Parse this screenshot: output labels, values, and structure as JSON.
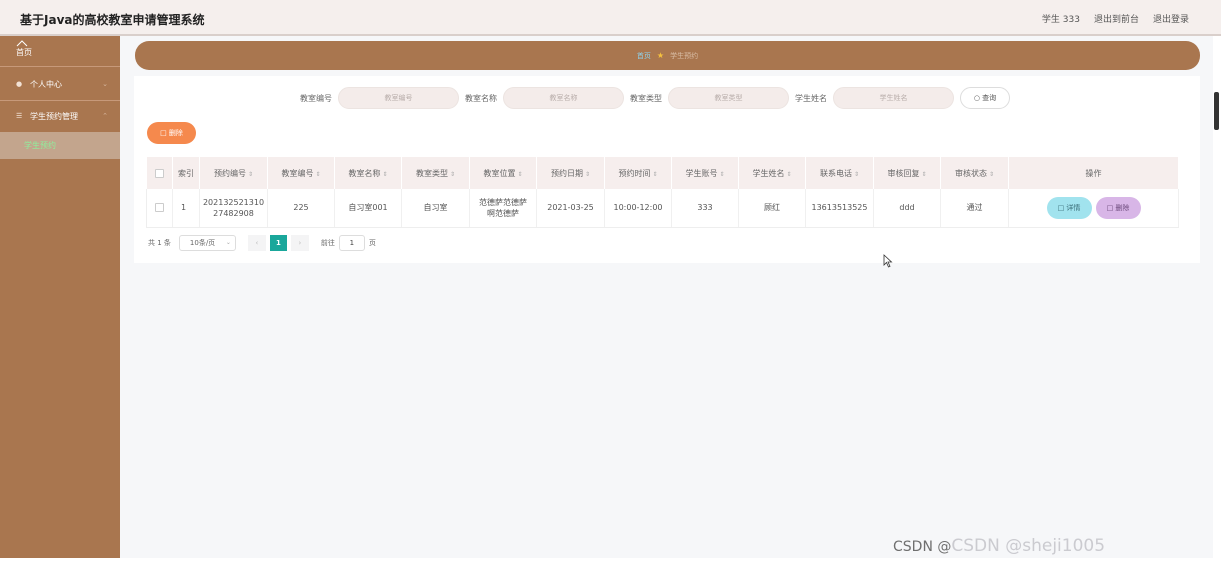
{
  "header": {
    "title": "基于Java的高校教室申请管理系统",
    "user": "学生 333",
    "back_front": "退出到前台",
    "logout": "退出登录"
  },
  "sidebar": {
    "home_label": "首页",
    "items": [
      {
        "label": "个人中心",
        "icon": "user-icon"
      },
      {
        "label": "学生预约管理",
        "icon": "menu-icon"
      }
    ],
    "sub_item": "学生预约"
  },
  "breadcrumb": {
    "home": "首页",
    "current": "学生预约"
  },
  "search": {
    "fields": [
      {
        "label": "教室编号",
        "placeholder": "教室编号"
      },
      {
        "label": "教室名称",
        "placeholder": "教室名称"
      },
      {
        "label": "教室类型",
        "placeholder": "教室类型"
      },
      {
        "label": "学生姓名",
        "placeholder": "学生姓名"
      }
    ],
    "query_button": "查询"
  },
  "delete_button": "删除",
  "table": {
    "columns": [
      "索引",
      "预约编号",
      "教室编号",
      "教室名称",
      "教室类型",
      "教室位置",
      "预约日期",
      "预约时间",
      "学生账号",
      "学生姓名",
      "联系电话",
      "审核回复",
      "审核状态",
      "操作"
    ],
    "rows": [
      {
        "index": "1",
        "booking_no_1": "202132521310",
        "booking_no_2": "27482908",
        "room_no": "225",
        "room_name": "自习室001",
        "room_type": "自习室",
        "location_1": "范德萨范德萨",
        "location_2": "啊范德萨",
        "date": "2021-03-25",
        "time": "10:00-12:00",
        "account": "333",
        "student_name": "顾红",
        "phone": "13613513525",
        "reply": "ddd",
        "status": "通过",
        "detail_label": "详情",
        "delete_label": "删除"
      }
    ]
  },
  "pagination": {
    "total": "共 1 条",
    "page_size": "10条/页",
    "current_page": "1",
    "goto_prefix": "前往",
    "goto_value": "1",
    "goto_suffix": "页"
  },
  "watermark": {
    "part1": "CSDN @",
    "part2": "CSDN @sheji1005"
  },
  "colors": {
    "sidebar": "#a9764f",
    "accent": "#1aa79b",
    "delete": "#f5894d"
  }
}
